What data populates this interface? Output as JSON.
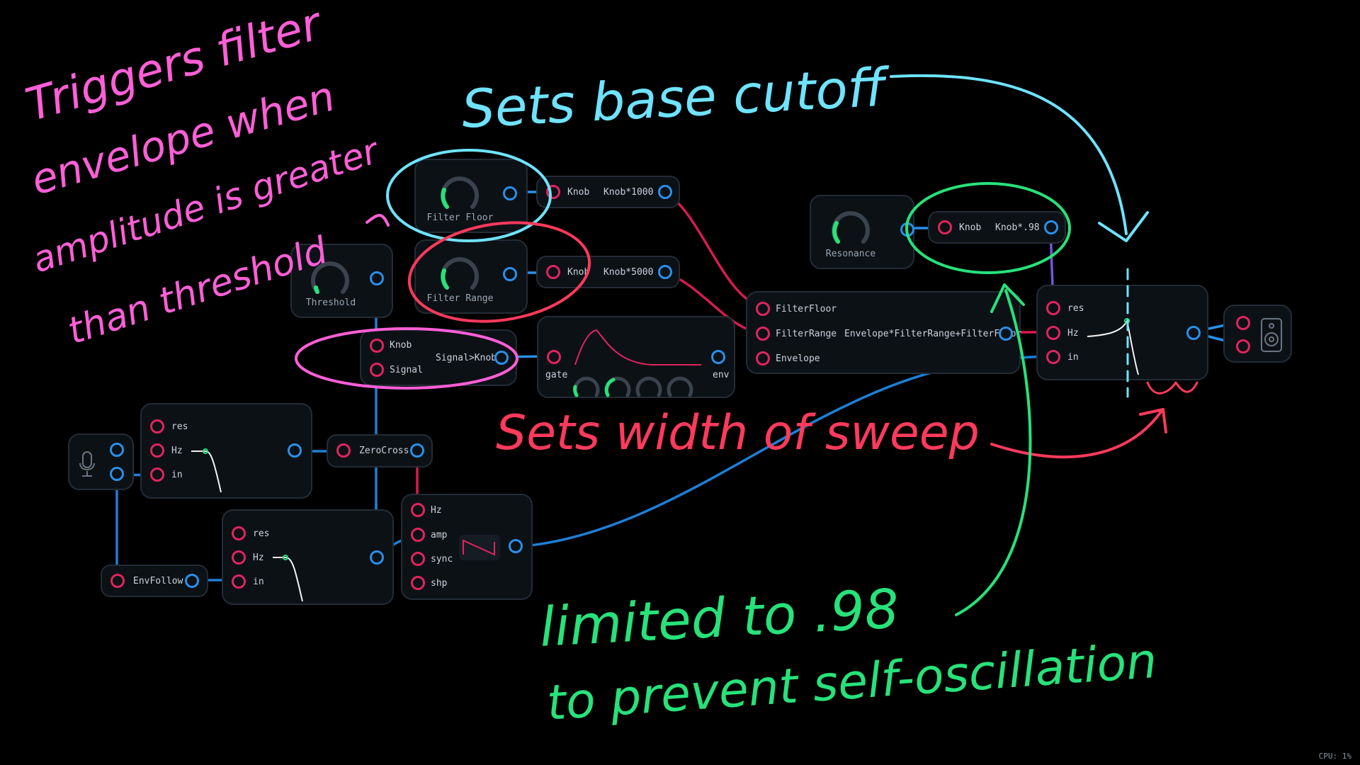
{
  "status": {
    "cpu": "CPU: 1%"
  },
  "colors": {
    "input_port": "#e0245e",
    "output_port": "#2a8fe8",
    "annotation_pink": "#ff5fd7",
    "annotation_cyan": "#6fe3ff",
    "annotation_red": "#ff3a5c",
    "annotation_green": "#27e27a"
  },
  "modules": {
    "filter_floor": {
      "label": "Filter Floor"
    },
    "filter_range": {
      "label": "Filter Range"
    },
    "threshold": {
      "label": "Threshold"
    },
    "resonance": {
      "label": "Resonance"
    },
    "knob_floor_expr": {
      "input": "Knob",
      "expr": "Knob*1000"
    },
    "knob_range_expr": {
      "input": "Knob",
      "expr": "Knob*5000"
    },
    "knob_res_expr": {
      "input": "Knob",
      "expr": "Knob*.98"
    },
    "compare": {
      "input1": "Knob",
      "input2": "Signal",
      "expr": "Signal>Knob"
    },
    "envelope": {
      "gate": "gate",
      "env": "env"
    },
    "mix_expr": {
      "in1": "FilterFloor",
      "in2": "FilterRange",
      "in3": "Envelope",
      "expr": "Envelope*FilterRange+FilterFloor"
    },
    "main_filter": {
      "res": "res",
      "hz": "Hz",
      "in": "in"
    },
    "pre_filter": {
      "res": "res",
      "hz": "Hz",
      "in": "in"
    },
    "low_filter": {
      "res": "res",
      "hz": "Hz",
      "in": "in"
    },
    "zerocross": {
      "label": "ZeroCross"
    },
    "envfollow": {
      "label": "EnvFollow"
    },
    "osc": {
      "hz": "Hz",
      "amp": "amp",
      "sync": "sync",
      "shp": "shp"
    }
  },
  "annotations": {
    "pink_line1": "Triggers filter",
    "pink_line2": "envelope when",
    "pink_line3": "amplitude is greater",
    "pink_line4": "than threshold",
    "cyan": "Sets base cutoff",
    "red": "Sets width of sweep",
    "green_line1": "limited to .98",
    "green_line2": "to prevent self-oscillation"
  }
}
